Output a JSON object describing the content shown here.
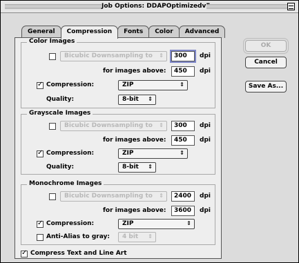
{
  "window": {
    "title": "Job Options: DDAPOptimizedv5"
  },
  "tabs": [
    {
      "label": "General"
    },
    {
      "label": "Compression"
    },
    {
      "label": "Fonts"
    },
    {
      "label": "Color"
    },
    {
      "label": "Advanced"
    }
  ],
  "buttons": {
    "ok": "OK",
    "cancel": "Cancel",
    "save_as": "Save As..."
  },
  "color_images": {
    "group_label": "Color Images",
    "downsampling": {
      "checked": false,
      "method": "Bicubic Downsampling to",
      "resolution": "300",
      "unit": "dpi",
      "above_label": "for images above:",
      "above_value": "450",
      "above_unit": "dpi"
    },
    "compression": {
      "checked": true,
      "label": "Compression:",
      "value": "ZIP"
    },
    "quality": {
      "label": "Quality:",
      "value": "8-bit"
    }
  },
  "grayscale_images": {
    "group_label": "Grayscale Images",
    "downsampling": {
      "checked": false,
      "method": "Bicubic Downsampling to",
      "resolution": "300",
      "unit": "dpi",
      "above_label": "for images above:",
      "above_value": "450",
      "above_unit": "dpi"
    },
    "compression": {
      "checked": true,
      "label": "Compression:",
      "value": "ZIP"
    },
    "quality": {
      "label": "Quality:",
      "value": "8-bit"
    }
  },
  "monochrome_images": {
    "group_label": "Monochrome Images",
    "downsampling": {
      "checked": false,
      "method": "Bicubic Downsampling to",
      "resolution": "2400",
      "unit": "dpi",
      "above_label": "for images above:",
      "above_value": "3600",
      "above_unit": "dpi"
    },
    "compression": {
      "checked": true,
      "label": "Compression:",
      "value": "ZIP"
    },
    "anti_alias": {
      "checked": false,
      "label": "Anti-Alias to gray:",
      "value": "4 bit"
    }
  },
  "compress_text": {
    "checked": true,
    "label": "Compress Text and Line Art"
  }
}
